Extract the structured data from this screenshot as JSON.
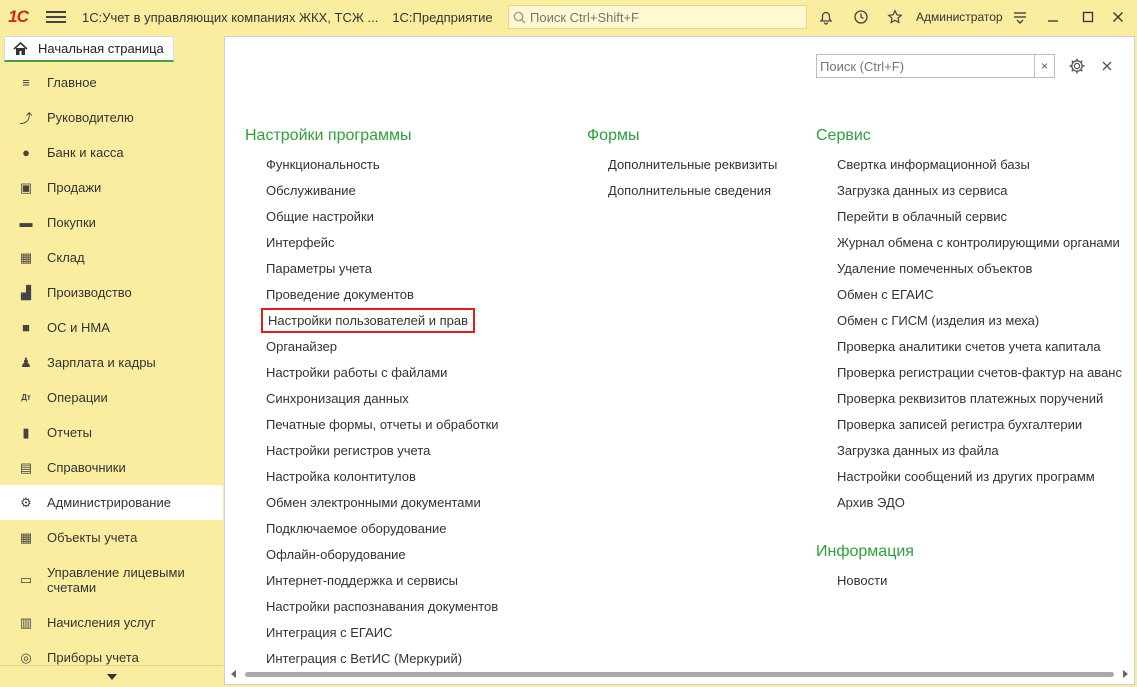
{
  "titlebar": {
    "logo": "1С",
    "title": "1С:Учет в управляющих компаниях ЖКХ, ТСЖ ...",
    "app": "1С:Предприятие",
    "search_placeholder": "Поиск Ctrl+Shift+F",
    "user": "Администратор"
  },
  "home_tab": {
    "label": "Начальная страница"
  },
  "sidebar": {
    "items": [
      {
        "label": "Главное",
        "icon": "≡"
      },
      {
        "label": "Руководителю",
        "icon": "⤴"
      },
      {
        "label": "Банк и касса",
        "icon": "●"
      },
      {
        "label": "Продажи",
        "icon": "▣"
      },
      {
        "label": "Покупки",
        "icon": "▬"
      },
      {
        "label": "Склад",
        "icon": "▦"
      },
      {
        "label": "Производство",
        "icon": "▟"
      },
      {
        "label": "ОС и НМА",
        "icon": "■"
      },
      {
        "label": "Зарплата и кадры",
        "icon": "♟"
      },
      {
        "label": "Операции",
        "icon": "Дт"
      },
      {
        "label": "Отчеты",
        "icon": "▮"
      },
      {
        "label": "Справочники",
        "icon": "▤"
      },
      {
        "label": "Администрирование",
        "icon": "⚙"
      },
      {
        "label": "Объекты учета",
        "icon": "▦"
      },
      {
        "label": "Управление лицевыми счетами",
        "icon": "▭"
      },
      {
        "label": "Начисления услуг",
        "icon": "▥"
      },
      {
        "label": "Приборы учета",
        "icon": "◎"
      }
    ],
    "active_index": 12
  },
  "panel": {
    "search_placeholder": "Поиск (Ctrl+F)",
    "sections": {
      "settings": {
        "title": "Настройки программы",
        "links": [
          "Функциональность",
          "Обслуживание",
          "Общие настройки",
          "Интерфейс",
          "Параметры учета",
          "Проведение документов",
          "Настройки пользователей и прав",
          "Органайзер",
          "Настройки работы с файлами",
          "Синхронизация данных",
          "Печатные формы, отчеты и обработки",
          "Настройки регистров учета",
          "Настройка колонтитулов",
          "Обмен электронными документами",
          "Подключаемое оборудование",
          "Офлайн-оборудование",
          "Интернет-поддержка и сервисы",
          "Настройки распознавания документов",
          "Интеграция с ЕГАИС",
          "Интеграция с ВетИС (Меркурий)"
        ]
      },
      "forms": {
        "title": "Формы",
        "links": [
          "Дополнительные реквизиты",
          "Дополнительные сведения"
        ]
      },
      "service": {
        "title": "Сервис",
        "links": [
          "Свертка информационной базы",
          "Загрузка данных из сервиса",
          "Перейти в облачный сервис",
          "Журнал обмена с контролирующими органами",
          "Удаление помеченных объектов",
          "Обмен с ЕГАИС",
          "Обмен с ГИСМ (изделия из меха)",
          "Проверка аналитики счетов учета капитала",
          "Проверка регистрации счетов-фактур на аванс",
          "Проверка реквизитов платежных поручений",
          "Проверка записей регистра бухгалтерии",
          "Загрузка данных из файла",
          "Настройки сообщений из других программ",
          "Архив ЭДО"
        ]
      },
      "info": {
        "title": "Информация",
        "links": [
          "Новости"
        ]
      }
    },
    "highlighted_link": "Настройки пользователей и прав"
  },
  "colors": {
    "chrome": "#fbeda0",
    "section_heading": "#2ea03c",
    "highlight_box": "#e01e1e"
  }
}
